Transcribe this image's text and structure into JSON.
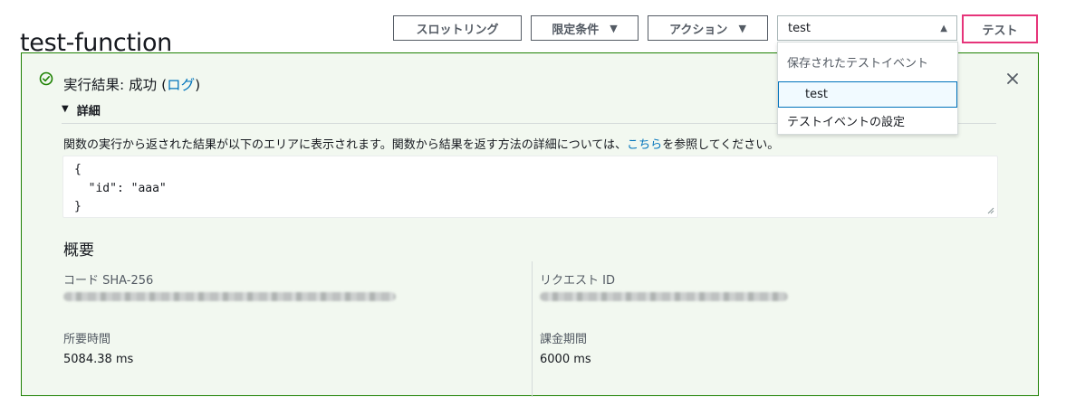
{
  "header": {
    "title": "test-function",
    "throttle_label": "スロットリング",
    "qualifier_label": "限定条件",
    "actions_label": "アクション",
    "test_event_select_value": "test",
    "test_button_label": "テスト"
  },
  "test_event_dropdown": {
    "group_label": "保存されたテストイベント",
    "options": [
      {
        "label": "test",
        "selected": true
      }
    ],
    "configure_label": "テストイベントの設定"
  },
  "result": {
    "status_prefix": "実行結果: 成功 (",
    "log_link": "ログ",
    "status_suffix": ")",
    "details_label": "詳細",
    "description_prefix": "関数の実行から返された結果が以下のエリアに表示されます。関数から結果を返す方法の詳細については、",
    "description_link": "こちら",
    "description_suffix": "を参照してください。",
    "output_lines": [
      "{",
      "  \"id\": \"aaa\"",
      "}"
    ]
  },
  "summary": {
    "title": "概要",
    "code_sha_label": "コード SHA-256",
    "request_id_label": "リクエスト ID",
    "duration_label": "所要時間",
    "duration_value": "5084.38 ms",
    "billed_duration_label": "課金期間",
    "billed_duration_value": "6000 ms"
  },
  "colors": {
    "success_green": "#1d8102",
    "link_blue": "#0073bb",
    "test_button_border": "#e6347a",
    "panel_background": "#f2f8f0"
  },
  "icons": {
    "status": "check-circle-icon",
    "close": "close-icon",
    "details_toggle": "caret-down-icon"
  }
}
